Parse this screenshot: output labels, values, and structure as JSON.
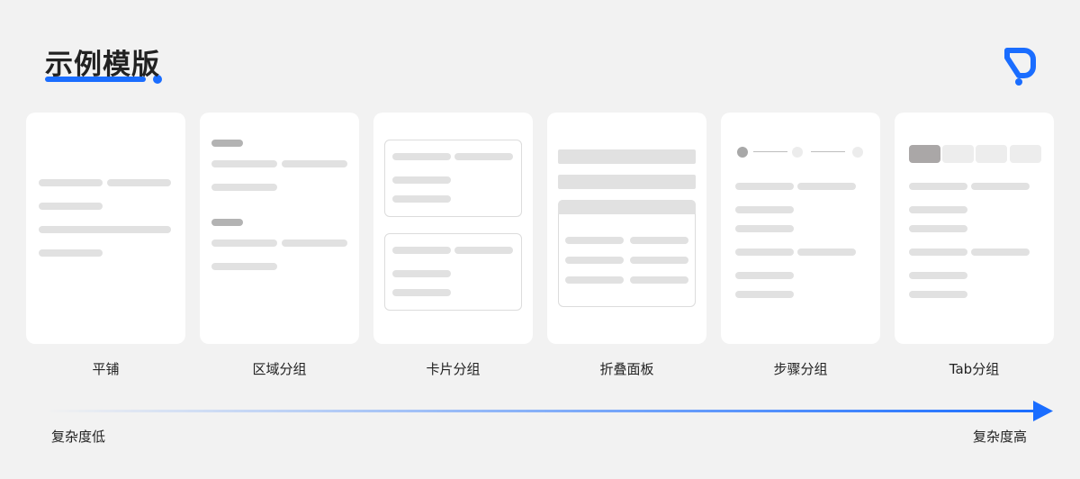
{
  "header": {
    "title": "示例模版"
  },
  "logo": {
    "icon": "brand-logo-icon",
    "color": "#1a6dff"
  },
  "accent_color": "#1a6dff",
  "cards": [
    {
      "label": "平铺"
    },
    {
      "label": "区域分组"
    },
    {
      "label": "卡片分组"
    },
    {
      "label": "折叠面板"
    },
    {
      "label": "步骤分组"
    },
    {
      "label": "Tab分组"
    }
  ],
  "axis": {
    "low_label": "复杂度低",
    "high_label": "复杂度高"
  }
}
